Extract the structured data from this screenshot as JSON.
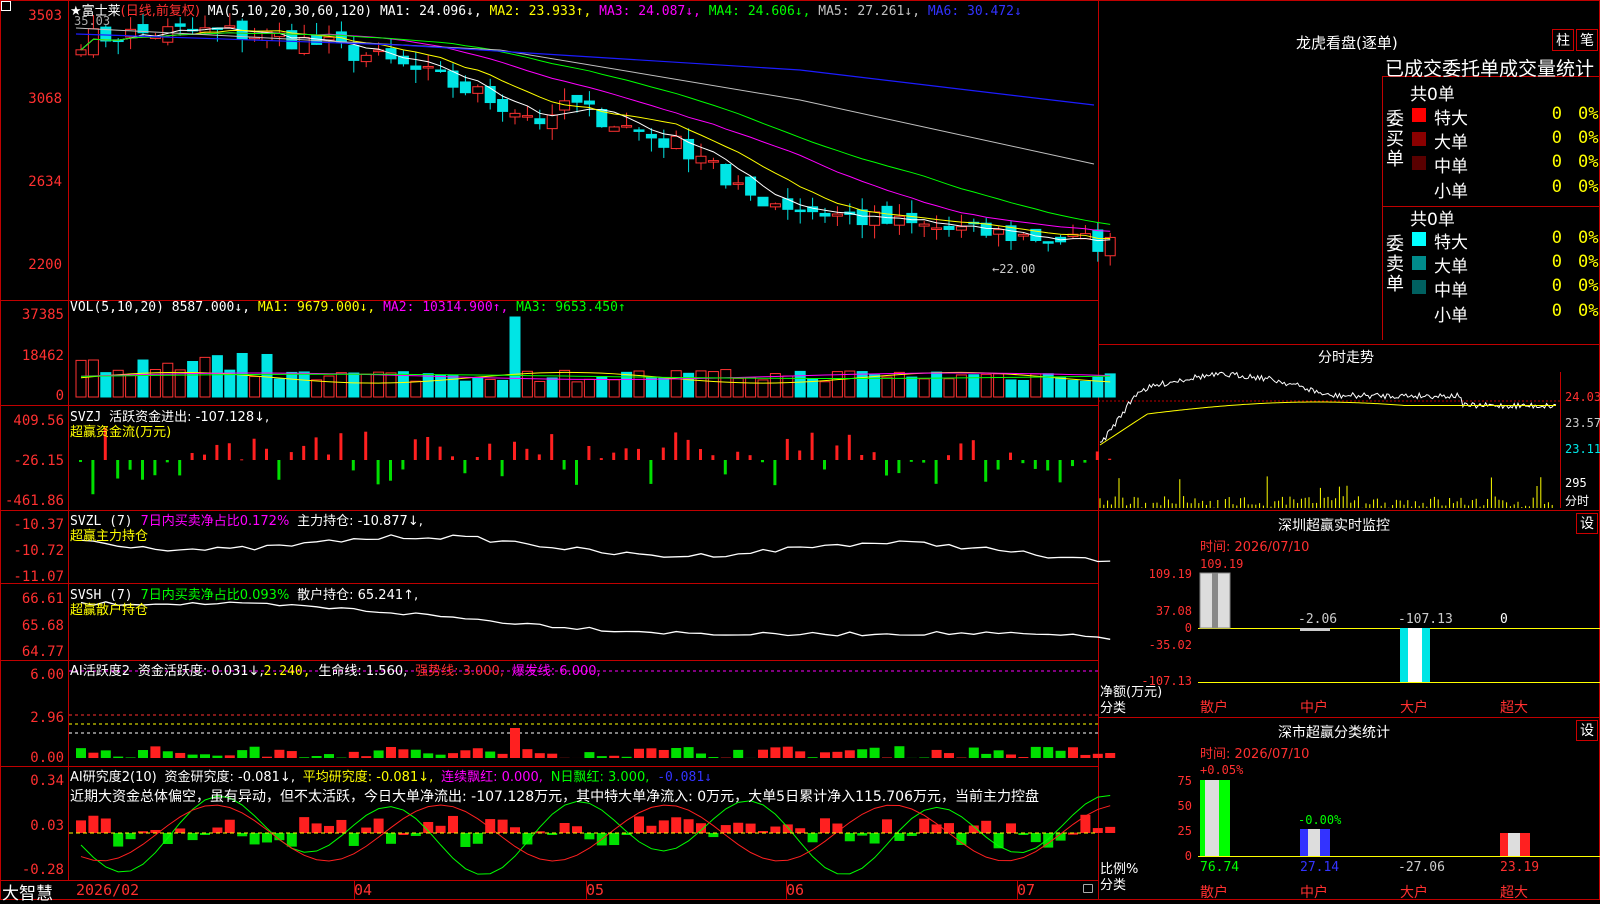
{
  "colors": {
    "up": "#ff3232",
    "down": "#00e5e5",
    "grid": "#b00000",
    "axis_text": "#ff3030",
    "ma1": "#ffffff",
    "ma2": "#ffff00",
    "ma3": "#ff00ff",
    "ma4": "#00ff00",
    "ma5": "#c0c0c0",
    "ma6": "#0000ff"
  },
  "main": {
    "stock": "★富士莱",
    "mode": "(日线,前复权)",
    "ma_label": "MA(5,10,20,30,60,120)",
    "ma1": "MA1: 24.096↓,",
    "ma2": "MA2: 23.933↑,",
    "ma3": "MA3: 24.087↓,",
    "ma4": "MA4: 24.606↓,",
    "ma5": "MA5: 27.261↓,",
    "ma6": "MA6: 30.472↓",
    "high_label": "35.03",
    "low_label": "←22.00",
    "y_ticks": [
      "3503",
      "3068",
      "2634",
      "2200"
    ]
  },
  "vol": {
    "label": "VOL(5,10,20)",
    "value": "8587.000↓,",
    "ma1": "MA1: 9679.000↓,",
    "ma2": "MA2: 10314.900↑,",
    "ma3": "MA3: 9653.450↑",
    "y_ticks": [
      "37385",
      "18462",
      "0"
    ]
  },
  "svzj": {
    "label": "SVZJ",
    "text": "活跃资金进出: -107.128↓,",
    "sub": "超赢资金流(万元)",
    "y_ticks": [
      "409.56",
      "-26.15",
      "-461.86"
    ]
  },
  "svzl": {
    "label": "SVZL (7)",
    "pct": "7日内买卖净占比0.172%",
    "text": "主力持仓: -10.877↓,",
    "sub": "超赢主力持仓",
    "y_ticks": [
      "-10.37",
      "-10.72",
      "-11.07"
    ]
  },
  "svsh": {
    "label": "SVSH (7)",
    "pct": "7日内买卖净占比0.093%",
    "text": "散户持仓: 65.241↑,",
    "sub": "超赢散户持仓",
    "y_ticks": [
      "66.61",
      "65.68",
      "64.77"
    ]
  },
  "ai1": {
    "label": "AI活跃度2",
    "t1": "资金活跃度: 0.031↓,",
    "t2": "2.240,",
    "t3": "生命线: 1.560,",
    "t4": "强势线: 3.000,",
    "t5": "爆发线: 6.000,",
    "y_ticks": [
      "6.00",
      "2.96",
      "0.00"
    ]
  },
  "ai2": {
    "label": "AI研究度2(10)",
    "t1": "资金研究度: -0.081↓,",
    "t2": "平均研究度: -0.081↓,",
    "t3": "连续飘红: 0.000,",
    "t4": "N日飘红: 3.000,",
    "t5": "-0.081↓",
    "comment": "近期大资金总体偏空，虽有异动，但不太活跃，今日大单净流出: -107.128万元，其中特大单净流入: 0万元，大单5日累计净入115.706万元，当前主力控盘",
    "y_ticks": [
      "0.34",
      "0.03",
      "-0.28"
    ]
  },
  "xaxis": {
    "app": "大智慧",
    "labels": [
      "2026/02",
      "04",
      "05",
      "06",
      "07"
    ]
  },
  "lhb": {
    "title": "龙虎看盘(逐单)",
    "btn1": "柱",
    "btn2": "笔",
    "subtitle": "已成交委托单成交量统计",
    "buy": {
      "side": "委买单",
      "total": "共0单",
      "rows": [
        {
          "name": "特大",
          "v": "0",
          "p": "0%",
          "c": "#ff0000"
        },
        {
          "name": "大单",
          "v": "0",
          "p": "0%",
          "c": "#8b0000"
        },
        {
          "name": "中单",
          "v": "0",
          "p": "0%",
          "c": "#5a0000"
        },
        {
          "name": "小单",
          "v": "0",
          "p": "0%",
          "c": "#000000"
        }
      ]
    },
    "sell": {
      "side": "委卖单",
      "total": "共0单",
      "rows": [
        {
          "name": "特大",
          "v": "0",
          "p": "0%",
          "c": "#00ffff"
        },
        {
          "name": "大单",
          "v": "0",
          "p": "0%",
          "c": "#008b8b"
        },
        {
          "name": "中单",
          "v": "0",
          "p": "0%",
          "c": "#006060"
        },
        {
          "name": "小单",
          "v": "0",
          "p": "0%",
          "c": "#000000"
        }
      ]
    }
  },
  "intraday": {
    "title": "分时走势",
    "y_ticks": [
      "24.03",
      "23.57",
      "23.11"
    ],
    "vol_tick": "295",
    "vol_label": "分时"
  },
  "monitor": {
    "title": "深圳超赢实时监控",
    "btn": "设",
    "time": "时间: 2026/07/10",
    "y_ticks": [
      "109.19",
      "37.08",
      "0",
      "-35.02",
      "-107.13"
    ],
    "unit": "净额(万元)",
    "cat_label": "分类",
    "cats": [
      "散户",
      "中户",
      "大户",
      "超大"
    ],
    "values": [
      "109.19",
      "-2.06",
      "-107.13",
      "0"
    ]
  },
  "classify": {
    "title": "深市超赢分类统计",
    "btn": "设",
    "time": "时间: 2026/07/10",
    "y_ticks": [
      "75",
      "50",
      "25",
      "0"
    ],
    "unit": "比例%",
    "cat_label": "分类",
    "cats": [
      "散户",
      "中户",
      "大户",
      "超大"
    ],
    "pct": [
      "+0.05%",
      "-0.00%"
    ],
    "values": [
      "76.74",
      "27.14",
      "-27.06",
      "23.19"
    ]
  }
}
